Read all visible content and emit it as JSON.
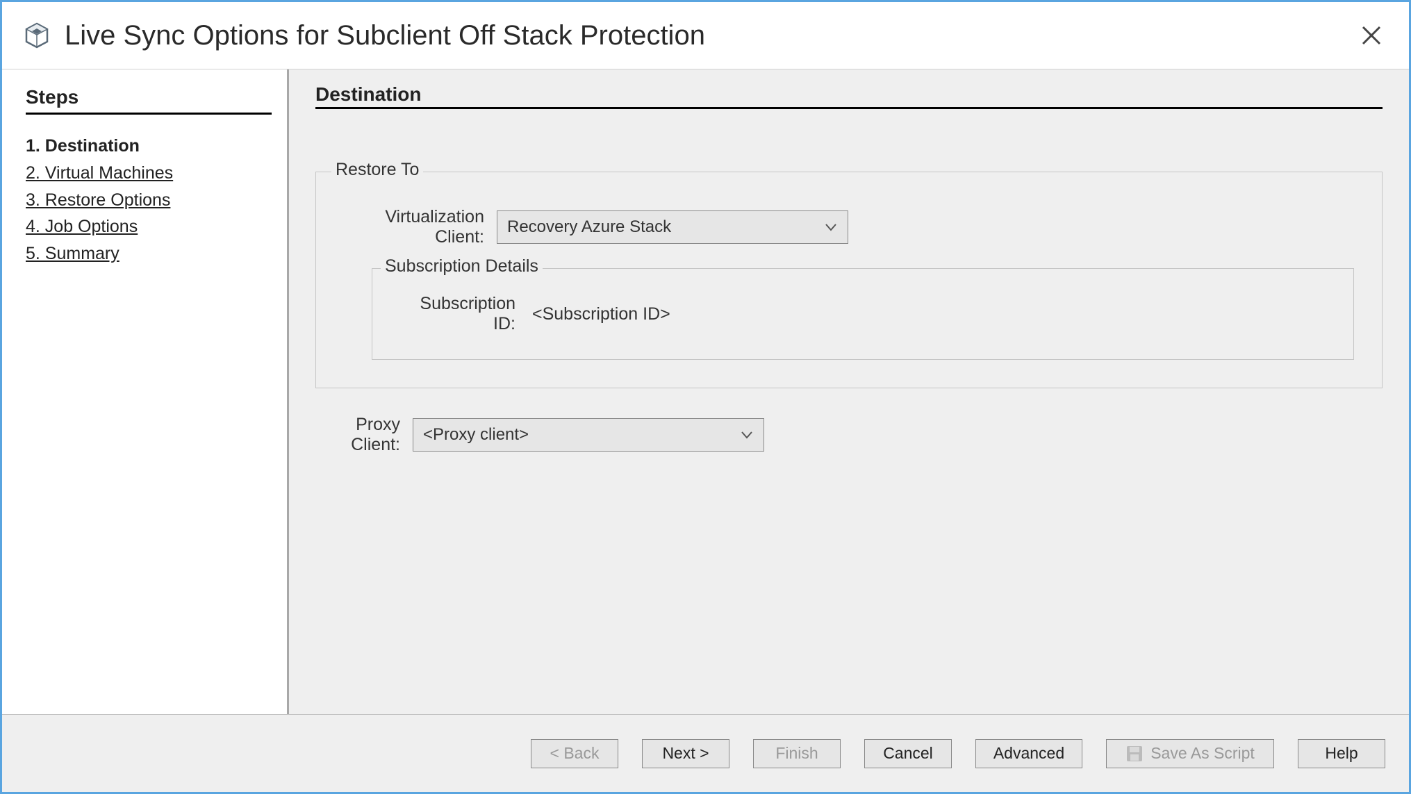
{
  "window": {
    "title": "Live Sync Options for Subclient Off Stack Protection"
  },
  "sidebar": {
    "heading": "Steps",
    "steps": [
      {
        "label": "1. Destination",
        "current": true
      },
      {
        "label": "2. Virtual Machines",
        "current": false
      },
      {
        "label": "3. Restore Options",
        "current": false
      },
      {
        "label": "4. Job Options",
        "current": false
      },
      {
        "label": "5. Summary",
        "current": false
      }
    ]
  },
  "main": {
    "heading": "Destination",
    "restore_to": {
      "legend": "Restore To",
      "virt_client_label": "Virtualization Client:",
      "virt_client_value": "Recovery Azure Stack",
      "subscription": {
        "legend": "Subscription Details",
        "id_label": "Subscription ID:",
        "id_value": "<Subscription ID>"
      }
    },
    "proxy": {
      "label": "Proxy Client:",
      "value": "<Proxy client>"
    }
  },
  "footer": {
    "back": "< Back",
    "next": "Next >",
    "finish": "Finish",
    "cancel": "Cancel",
    "advanced": "Advanced",
    "save_script": "Save As Script",
    "help": "Help"
  }
}
